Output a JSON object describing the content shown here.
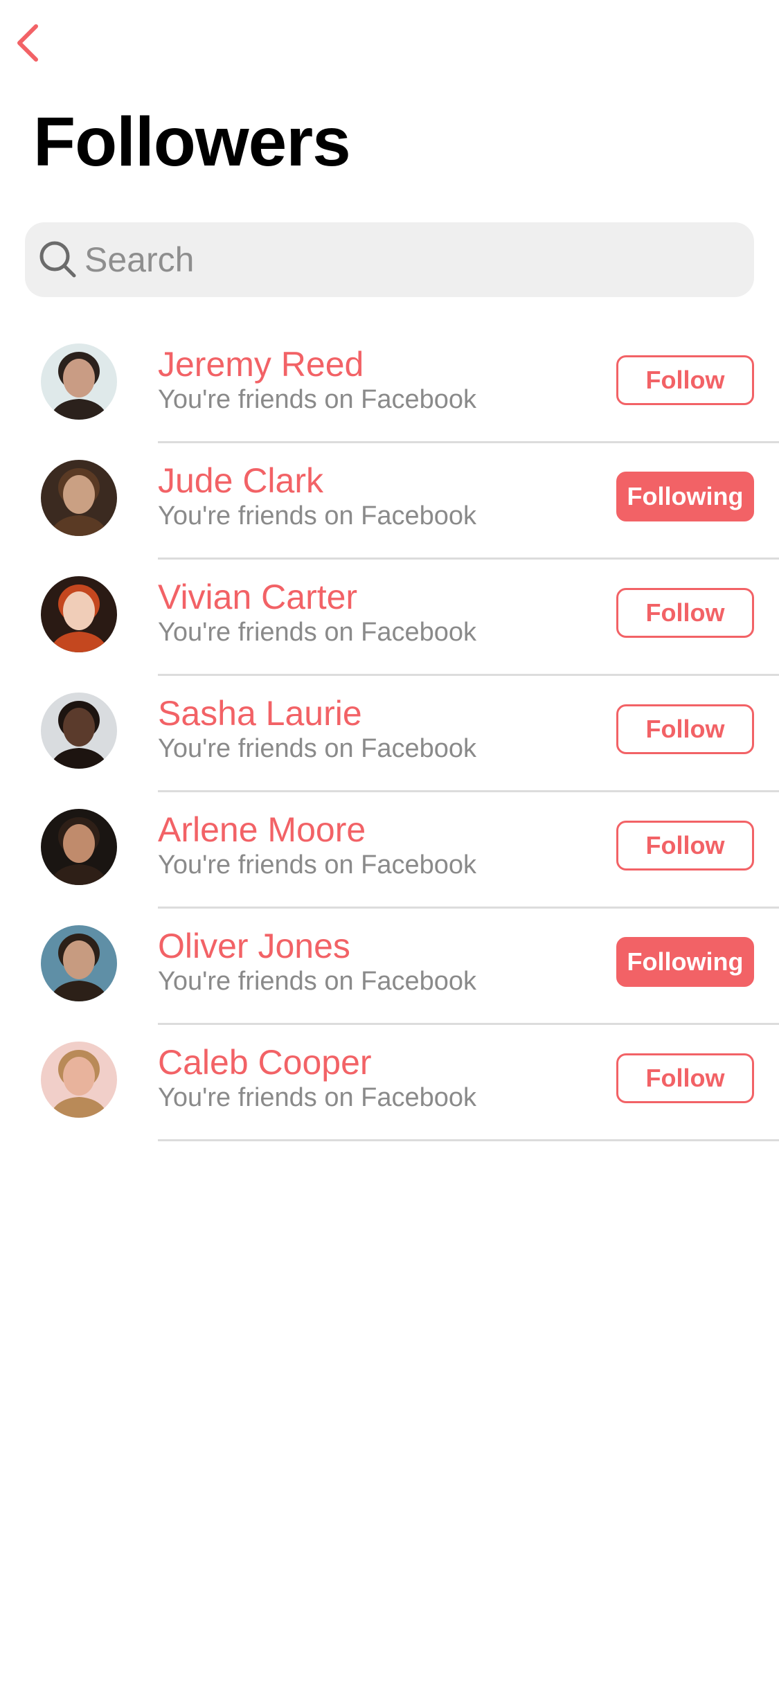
{
  "header": {
    "title": "Followers",
    "back_icon": "chevron-left-icon"
  },
  "search": {
    "placeholder": "Search",
    "value": "",
    "icon": "search-icon"
  },
  "colors": {
    "accent": "#f26266",
    "subtitle": "#8a8a8a",
    "search_bg": "#efefef",
    "divider": "#dcdcdc"
  },
  "followers": [
    {
      "name": "Jeremy Reed",
      "subtitle": "You're friends on Facebook",
      "button": "Follow",
      "following": false,
      "avatar": {
        "bg": "#dfe9ea",
        "skin": "#c99c84",
        "hair": "#2b211c"
      }
    },
    {
      "name": "Jude Clark",
      "subtitle": "You're friends on Facebook",
      "button": "Following",
      "following": true,
      "avatar": {
        "bg": "#3b2a20",
        "skin": "#caa083",
        "hair": "#5a3a24"
      }
    },
    {
      "name": "Vivian Carter",
      "subtitle": "You're friends on Facebook",
      "button": "Follow",
      "following": false,
      "avatar": {
        "bg": "#2a1a14",
        "skin": "#f0cdb8",
        "hair": "#c4471f"
      }
    },
    {
      "name": "Sasha Laurie",
      "subtitle": "You're friends on Facebook",
      "button": "Follow",
      "following": false,
      "avatar": {
        "bg": "#d9dcdf",
        "skin": "#5b3b2c",
        "hair": "#1d1410"
      }
    },
    {
      "name": "Arlene Moore",
      "subtitle": "You're friends on Facebook",
      "button": "Follow",
      "following": false,
      "avatar": {
        "bg": "#1a1512",
        "skin": "#c08b6c",
        "hair": "#2e1f17"
      }
    },
    {
      "name": "Oliver Jones",
      "subtitle": "You're friends on Facebook",
      "button": "Following",
      "following": true,
      "avatar": {
        "bg": "#5f8fa6",
        "skin": "#c79b80",
        "hair": "#2c2018"
      }
    },
    {
      "name": "Caleb Cooper",
      "subtitle": "You're friends on Facebook",
      "button": "Follow",
      "following": false,
      "avatar": {
        "bg": "#f1cfc9",
        "skin": "#e8b39c",
        "hair": "#b98a58"
      }
    }
  ]
}
